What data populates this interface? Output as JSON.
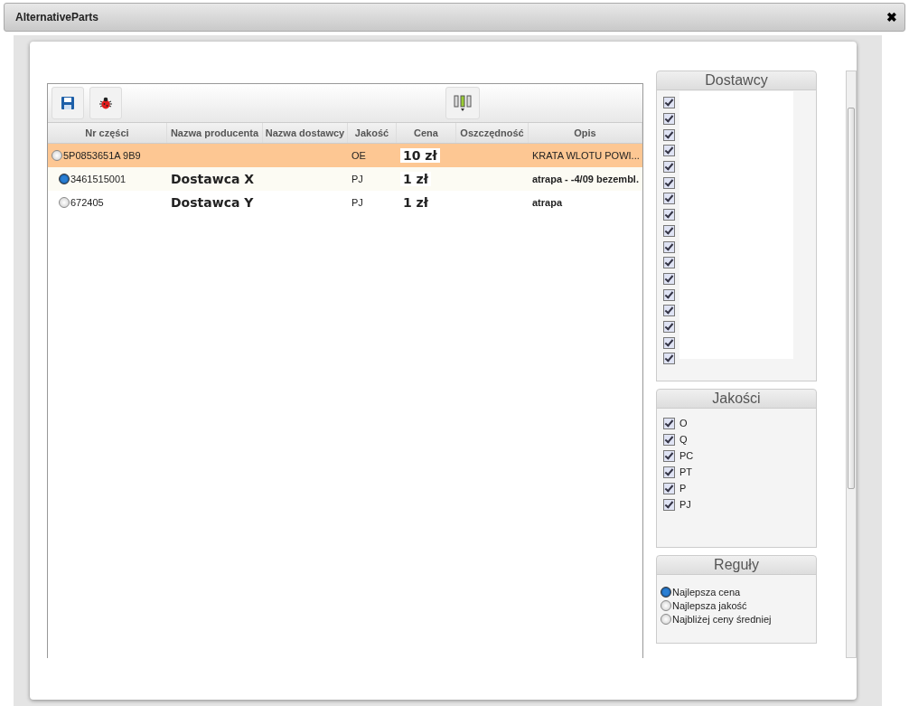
{
  "window": {
    "title": "AlternativeParts",
    "close": "✖"
  },
  "table": {
    "columns": [
      "Nr części",
      "Nazwa producenta",
      "Nazwa dostawcy",
      "Jakość",
      "Cena",
      "Oszczędność",
      "Opis"
    ],
    "rows": [
      {
        "selected": false,
        "highlighted": true,
        "part_no": "5P0853651A 9B9",
        "quality": "OE",
        "price": "10 zł",
        "description": "KRATA WLOTU POWI...",
        "children": [
          {
            "selected": true,
            "highlighted": false,
            "part_no": "3461515001",
            "producer": "Dostawca X",
            "quality": "PJ",
            "price": "1 zł",
            "description": "atrapa - -4/09 bezembl."
          },
          {
            "selected": false,
            "highlighted": false,
            "part_no": "672405",
            "producer": "Dostawca Y",
            "quality": "PJ",
            "price": "1 zł",
            "description": "atrapa"
          }
        ]
      }
    ]
  },
  "suppliers": {
    "title": "Dostawcy",
    "items": [
      {
        "checked": true
      },
      {
        "checked": true
      },
      {
        "checked": true
      },
      {
        "checked": true
      },
      {
        "checked": true
      },
      {
        "checked": true
      },
      {
        "checked": true
      },
      {
        "checked": true
      },
      {
        "checked": true
      },
      {
        "checked": true
      },
      {
        "checked": true
      },
      {
        "checked": true
      },
      {
        "checked": true
      },
      {
        "checked": true
      },
      {
        "checked": true
      },
      {
        "checked": true
      },
      {
        "checked": true
      }
    ]
  },
  "qualities": {
    "title": "Jakości",
    "items": [
      {
        "label": "O",
        "checked": true
      },
      {
        "label": "Q",
        "checked": true
      },
      {
        "label": "PC",
        "checked": true
      },
      {
        "label": "PT",
        "checked": true
      },
      {
        "label": "P",
        "checked": true
      },
      {
        "label": "PJ",
        "checked": true
      }
    ]
  },
  "rules": {
    "title": "Reguły",
    "items": [
      {
        "label": "Najlepsza cena",
        "selected": true
      },
      {
        "label": "Najlepsza jakość",
        "selected": false
      },
      {
        "label": "Najbliżej ceny średniej",
        "selected": false
      }
    ]
  }
}
